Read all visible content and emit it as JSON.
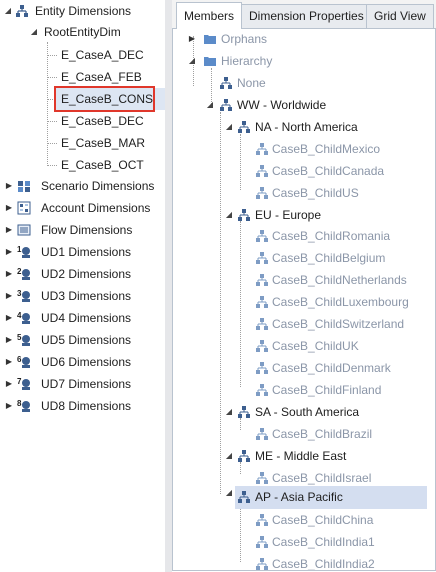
{
  "left_tree": {
    "entity_dimensions": "Entity Dimensions",
    "root_entity_dim": "RootEntityDim",
    "entities": [
      "E_CaseA_DEC",
      "E_CaseA_FEB",
      "E_CaseB_CONS",
      "E_CaseB_DEC",
      "E_CaseB_MAR",
      "E_CaseB_OCT"
    ],
    "selected_entity": "E_CaseB_CONS",
    "scenario_dimensions": "Scenario Dimensions",
    "account_dimensions": "Account Dimensions",
    "flow_dimensions": "Flow Dimensions",
    "ud": [
      {
        "num": "1",
        "label": "UD1 Dimensions"
      },
      {
        "num": "2",
        "label": "UD2 Dimensions"
      },
      {
        "num": "3",
        "label": "UD3 Dimensions"
      },
      {
        "num": "4",
        "label": "UD4 Dimensions"
      },
      {
        "num": "5",
        "label": "UD5 Dimensions"
      },
      {
        "num": "6",
        "label": "UD6 Dimensions"
      },
      {
        "num": "7",
        "label": "UD7 Dimensions"
      },
      {
        "num": "8",
        "label": "UD8 Dimensions"
      }
    ]
  },
  "tabs": {
    "members": "Members",
    "dimension_properties": "Dimension Properties",
    "grid_view": "Grid View"
  },
  "members_tree": {
    "orphans": "Orphans",
    "hierarchy": "Hierarchy",
    "none": "None",
    "ww": "WW - Worldwide",
    "na": "NA - North America",
    "na_children": [
      "CaseB_ChildMexico",
      "CaseB_ChildCanada",
      "CaseB_ChildUS"
    ],
    "eu": "EU - Europe",
    "eu_children": [
      "CaseB_ChildRomania",
      "CaseB_ChildBelgium",
      "CaseB_ChildNetherlands",
      "CaseB_ChildLuxembourg",
      "CaseB_ChildSwitzerland",
      "CaseB_ChildUK",
      "CaseB_ChildDenmark",
      "CaseB_ChildFinland"
    ],
    "sa": "SA - South America",
    "sa_children": [
      "CaseB_ChildBrazil"
    ],
    "me": "ME - Middle East",
    "me_children": [
      "CaseB_ChildIsrael"
    ],
    "ap": "AP - Asia Pacific",
    "ap_children": [
      "CaseB_ChildChina",
      "CaseB_ChildIndia1",
      "CaseB_ChildIndia2"
    ]
  },
  "colors": {
    "highlight_box": "#e0372b",
    "selected_row": "#d4def0",
    "member_icon": "#3d5f8f",
    "muted_text": "#8b96a8"
  }
}
